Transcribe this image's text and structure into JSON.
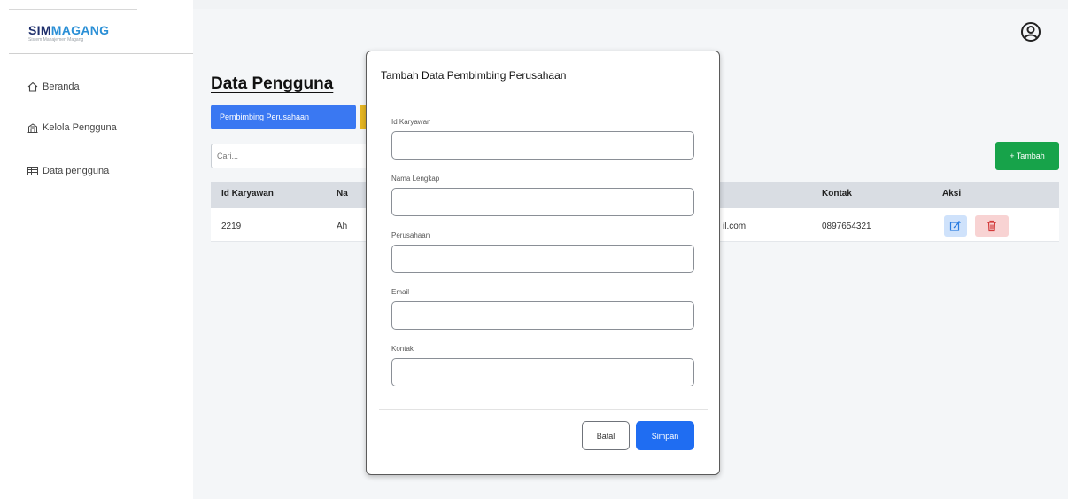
{
  "app": {
    "logo_main": "SIM",
    "logo_accent": "MAGANG",
    "logo_subtitle": "Sistem Manajemen Magang"
  },
  "sidebar": {
    "items": [
      {
        "label": "Beranda",
        "icon": "home-icon"
      },
      {
        "label": "Kelola Pengguna",
        "icon": "building-icon"
      },
      {
        "label": "Data pengguna",
        "icon": "table-icon"
      }
    ]
  },
  "header": {
    "user_icon": "user-circle-icon"
  },
  "page": {
    "title": "Data Pengguna",
    "tab_active": "Pembimbing Perusahaan",
    "search_placeholder": "Cari...",
    "add_button": "+ Tambah"
  },
  "table": {
    "columns": [
      "Id Karyawan",
      "Na",
      "Kontak",
      "Aksi"
    ],
    "rows": [
      {
        "id": "2219",
        "nama": "Ah",
        "email": "il.com",
        "kontak": "0897654321"
      }
    ]
  },
  "modal": {
    "title": "Tambah Data Pembimbing Perusahaan",
    "fields": [
      {
        "label": "Id Karyawan",
        "value": ""
      },
      {
        "label": "Nama Lengkap",
        "value": ""
      },
      {
        "label": "Perusahaan",
        "value": ""
      },
      {
        "label": "Email",
        "value": ""
      },
      {
        "label": "Kontak",
        "value": ""
      }
    ],
    "cancel_label": "Batal",
    "save_label": "Simpan"
  },
  "colors": {
    "primary": "#3a78f2",
    "success": "#17a34a",
    "danger": "#f8d3d3"
  }
}
